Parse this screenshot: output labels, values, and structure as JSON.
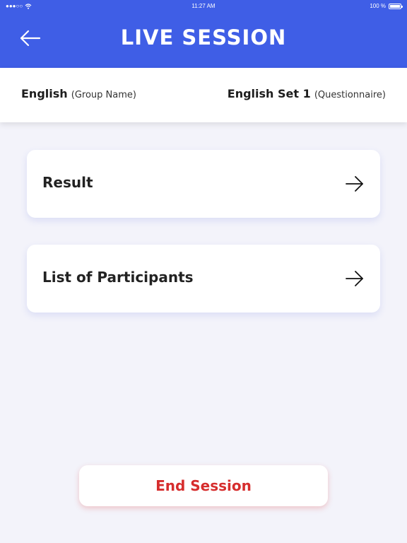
{
  "status_bar": {
    "signal_text": "●●●○○",
    "time": "11:27 AM",
    "battery_text": "100 %"
  },
  "header": {
    "title": "LIVE SESSION",
    "back_icon": "arrow-left-icon",
    "background_color": "#3f5ee6"
  },
  "info": {
    "group_name_value": "English",
    "group_name_label": "(Group Name)",
    "questionnaire_value": "English Set 1",
    "questionnaire_label": "(Questionnaire)"
  },
  "menu": {
    "items": [
      {
        "label": "Result",
        "icon": "arrow-right-icon"
      },
      {
        "label": "List of Participants",
        "icon": "arrow-right-icon"
      }
    ]
  },
  "footer": {
    "end_session_label": "End Session",
    "end_session_color": "#d62d2d"
  }
}
